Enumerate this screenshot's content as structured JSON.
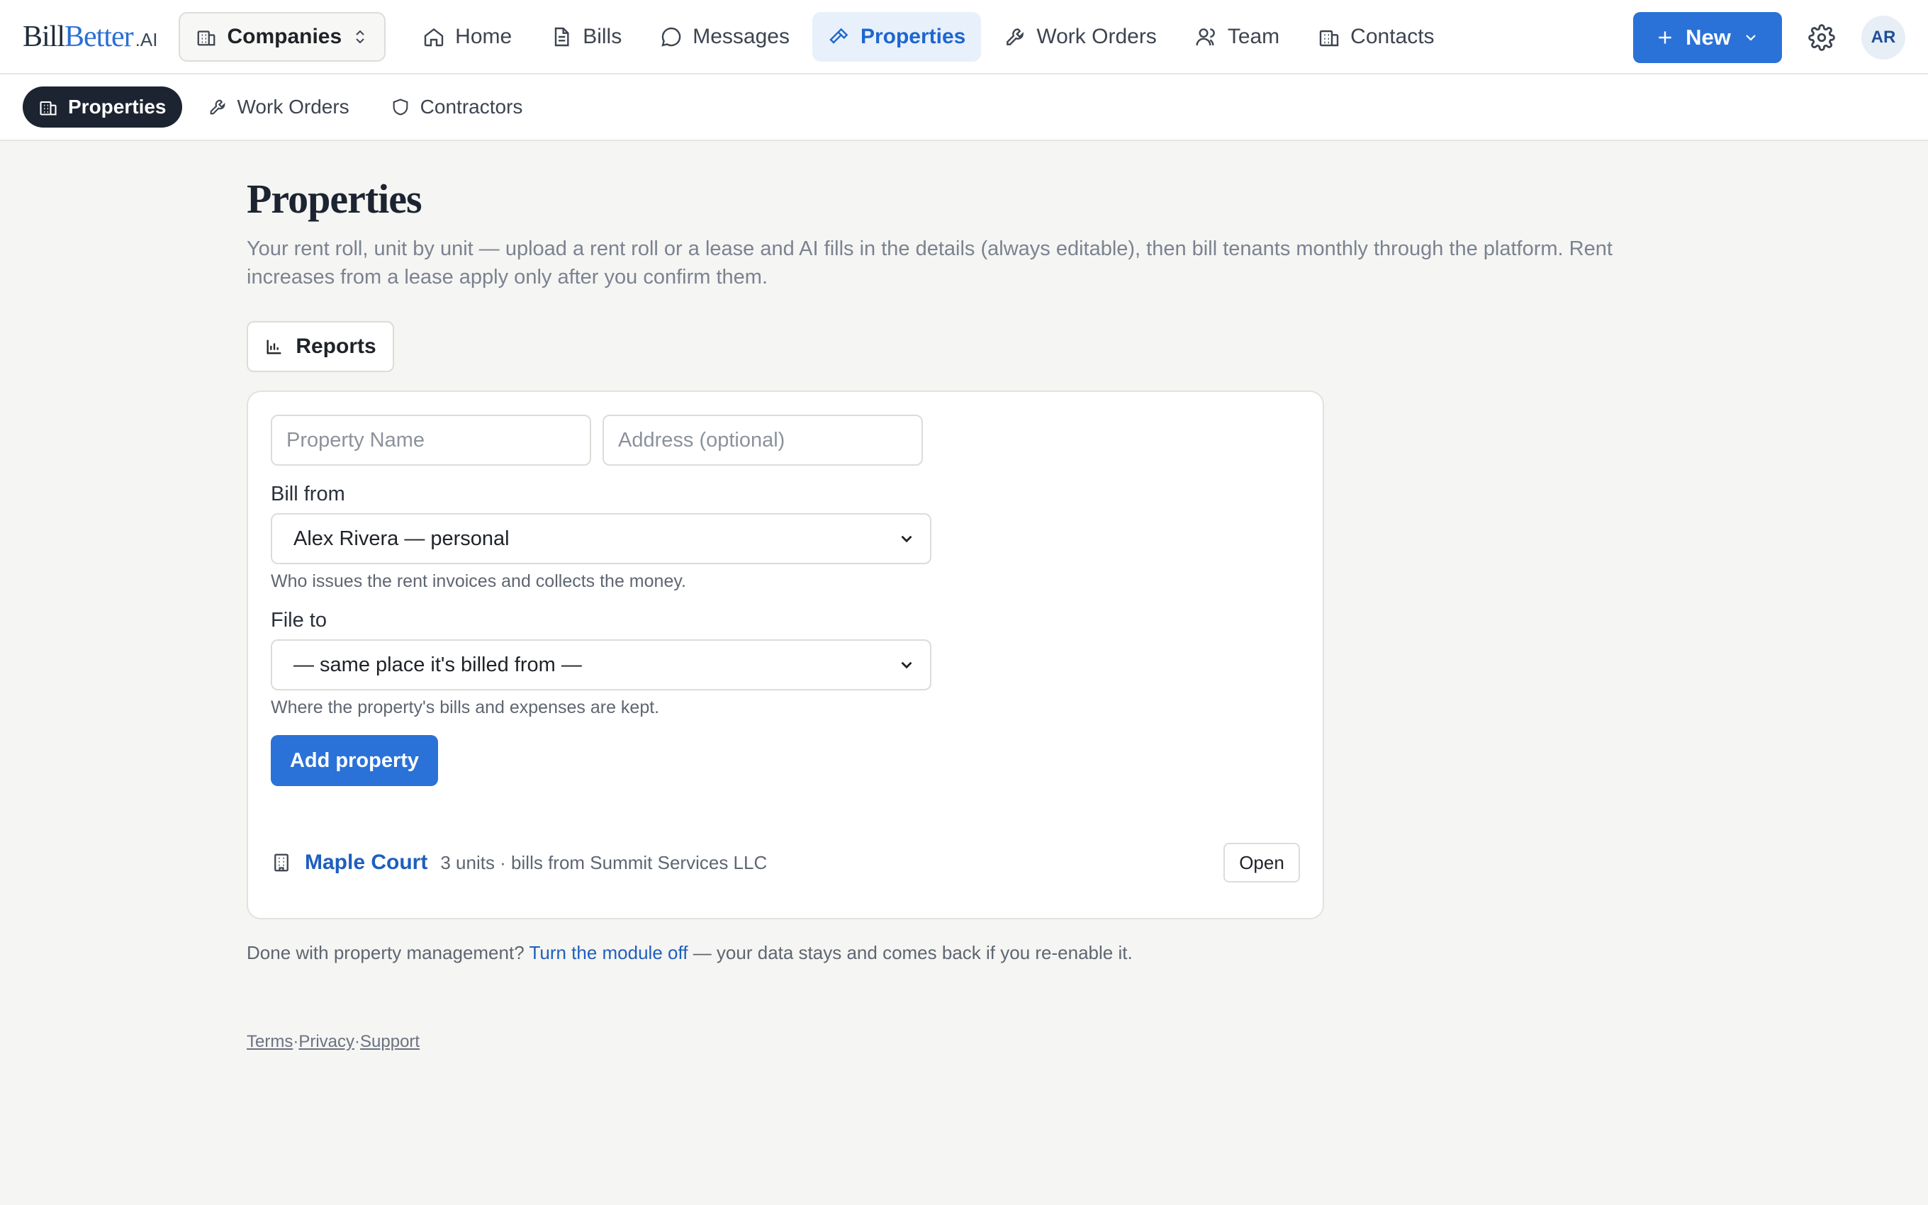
{
  "app": {
    "logo_part1": "Bill",
    "logo_part2": "Better",
    "logo_ai": ".AI"
  },
  "topbar": {
    "companies_label": "Companies",
    "nav": [
      {
        "label": "Home",
        "icon": "home-icon"
      },
      {
        "label": "Bills",
        "icon": "file-icon"
      },
      {
        "label": "Messages",
        "icon": "message-icon"
      },
      {
        "label": "Properties",
        "icon": "hammer-icon",
        "active": true
      },
      {
        "label": "Work Orders",
        "icon": "wrench-icon"
      },
      {
        "label": "Team",
        "icon": "users-icon"
      },
      {
        "label": "Contacts",
        "icon": "building-icon"
      }
    ],
    "new_label": "New",
    "avatar_initials": "AR"
  },
  "subnav": [
    {
      "label": "Properties",
      "icon": "building-icon",
      "active": true
    },
    {
      "label": "Work Orders",
      "icon": "wrench-icon"
    },
    {
      "label": "Contractors",
      "icon": "shield-icon"
    }
  ],
  "page": {
    "title": "Properties",
    "description": "Your rent roll, unit by unit — upload a rent roll or a lease and AI fills in the details (always editable), then bill tenants monthly through the platform. Rent increases from a lease apply only after you confirm them.",
    "reports_label": "Reports"
  },
  "form": {
    "property_name_placeholder": "Property Name",
    "address_placeholder": "Address (optional)",
    "bill_from_label": "Bill from",
    "bill_from_value": "Alex Rivera — personal",
    "bill_from_hint": "Who issues the rent invoices and collects the money.",
    "file_to_label": "File to",
    "file_to_value": "— same place it's billed from —",
    "file_to_hint": "Where the property's bills and expenses are kept.",
    "add_label": "Add property"
  },
  "properties": [
    {
      "name": "Maple Court",
      "meta": "3 units · bills from Summit Services LLC",
      "open_label": "Open"
    }
  ],
  "module": {
    "prefix": "Done with property management?",
    "link": "Turn the module off",
    "suffix": "— your data stays and comes back if you re-enable it."
  },
  "footer": {
    "terms": "Terms",
    "privacy": "Privacy",
    "support": "Support",
    "sep": "·"
  },
  "colors": {
    "accent": "#2a72d8",
    "active_pill": "#1c2431",
    "active_nav_bg": "#e8f0fb"
  }
}
